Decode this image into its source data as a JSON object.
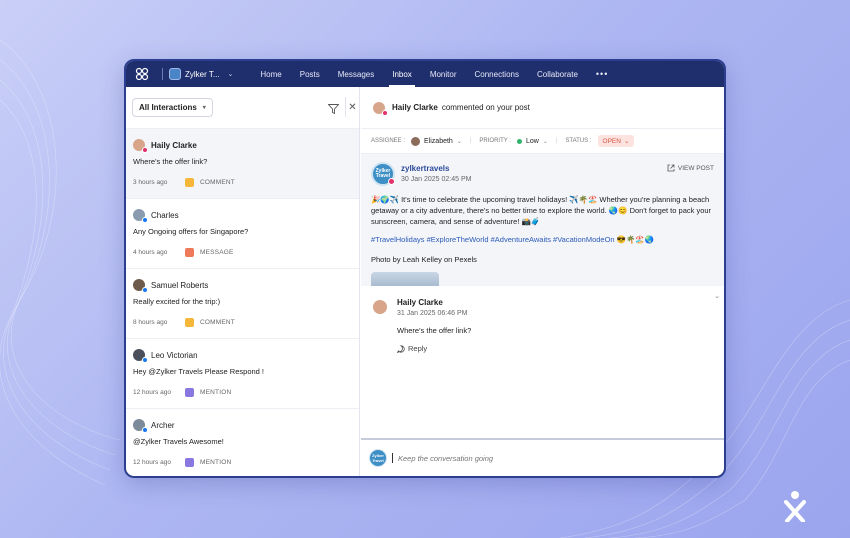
{
  "topbar": {
    "brand_name": "Zylker T...",
    "nav": [
      "Home",
      "Posts",
      "Messages",
      "Inbox",
      "Monitor",
      "Connections",
      "Collaborate"
    ],
    "active_nav": "Inbox",
    "more": "•••"
  },
  "left": {
    "filter_label": "All Interactions",
    "items": [
      {
        "name": "Haily Clarke",
        "text": "Where's the offer link?",
        "time": "3 hours ago",
        "type": "COMMENT",
        "network": "instagram",
        "active": true
      },
      {
        "name": "Charles",
        "text": "Any Ongoing offers for Singapore?",
        "time": "4 hours ago",
        "type": "MESSAGE",
        "network": "facebook"
      },
      {
        "name": "Samuel Roberts",
        "text": "Really excited for the trip:)",
        "time": "8 hours ago",
        "type": "COMMENT",
        "network": "facebook"
      },
      {
        "name": "Leo Victorian",
        "text": "Hey @Zylker Travels Please Respond !",
        "time": "12 hours ago",
        "type": "MENTION",
        "network": "facebook"
      },
      {
        "name": "Archer",
        "text": "@Zylker Travels Awesome!",
        "time": "12 hours ago",
        "type": "MENTION",
        "network": "facebook"
      }
    ]
  },
  "right": {
    "header_name": "Haily Clarke",
    "header_action": "commented on your post",
    "assignee_label": "ASSIGNEE :",
    "assignee_value": "Elizabeth",
    "priority_label": "PRIORITY :",
    "priority_value": "Low",
    "status_label": "STATUS :",
    "status_value": "OPEN",
    "post": {
      "account": "zylkertravels",
      "date": "30 Jan 2025 02:45 PM",
      "view_post": "VIEW POST",
      "logo_text": "Zylker Travel",
      "body": "🎉🌍✈️ It's time to celebrate the upcoming travel holidays! ✈️🌴🏖️ Whether you're planning a beach getaway or a city adventure, there's no better time to explore the world. 🌏😊 Don't forget to pack your sunscreen, camera, and sense of adventure! 📸🧳",
      "hashtags": "#TravelHolidays #ExploreTheWorld #AdventureAwaits #VacationModeOn 😎🌴🏖️🌏",
      "credit": "Photo by Leah Kelley on Pexels"
    },
    "reply": {
      "name": "Haily Clarke",
      "date": "31 Jan 2025 06:46 PM",
      "text": "Where's the offer link?",
      "reply_label": "Reply"
    },
    "composer_placeholder": "Keep the conversation going"
  },
  "colors": {
    "topbar": "#1f2f6e",
    "accent_link": "#2b4a9a",
    "status_open": "#d9533f",
    "priority_low": "#2fb46a"
  }
}
